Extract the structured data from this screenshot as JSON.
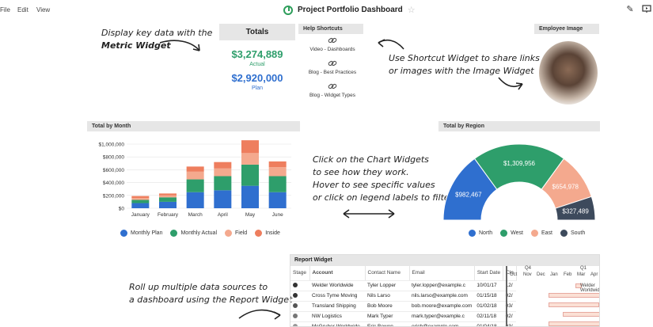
{
  "menu": [
    "File",
    "Edit",
    "View"
  ],
  "app_title": "Project Portfolio Dashboard",
  "notes": {
    "metric": [
      "Display key data with the",
      "Metric Widget"
    ],
    "shortcut": [
      "Use Shortcut Widget to share links",
      "or images with the Image Widget"
    ],
    "chart": [
      "Click on the Chart Widgets",
      "to see how they work.",
      "Hover to see specific values",
      "or click on legend labels to filter"
    ],
    "report": [
      "Roll up multiple data sources to",
      "a dashboard using the Report Widget"
    ]
  },
  "totals": {
    "title": "Totals",
    "actual_value": "$3,274,889",
    "actual_label": "Actual",
    "plan_value": "$2,920,000",
    "plan_label": "Plan"
  },
  "help_shortcuts": {
    "title": "Help Shortcuts",
    "items": [
      "Video - Dashboards",
      "Blog - Best Practices",
      "Blog - Widget Types"
    ]
  },
  "employee_image": {
    "title": "Employee Image"
  },
  "colors": {
    "plan": "#2f6fcf",
    "actual": "#2e9e6b",
    "field": "#f4a98e",
    "inside": "#ee7e5e",
    "north": "#2f6fcf",
    "west": "#2e9e6b",
    "east": "#f4a98e",
    "south": "#3d4a5c"
  },
  "chart_data": [
    {
      "type": "bar",
      "title": "Total by Month",
      "categories": [
        "January",
        "February",
        "March",
        "April",
        "May",
        "June"
      ],
      "ytick_labels": [
        "$1,000,000",
        "$800,000",
        "$600,000",
        "$400,000",
        "$200,000",
        "$0"
      ],
      "ylim": [
        0,
        1000000
      ],
      "stacked": true,
      "series": [
        {
          "name": "Monthly Plan",
          "values": [
            80000,
            100000,
            250000,
            280000,
            350000,
            250000
          ]
        },
        {
          "name": "Monthly Actual",
          "values": [
            50000,
            70000,
            200000,
            220000,
            330000,
            250000
          ]
        },
        {
          "name": "Field",
          "values": [
            30000,
            30000,
            120000,
            120000,
            180000,
            140000
          ]
        },
        {
          "name": "Inside",
          "values": [
            30000,
            30000,
            80000,
            100000,
            200000,
            90000
          ]
        }
      ]
    },
    {
      "type": "pie",
      "title": "Total by Region",
      "series": [
        {
          "name": "North",
          "value": 982467,
          "label": "$982,467"
        },
        {
          "name": "West",
          "value": 1309956,
          "label": "$1,309,956"
        },
        {
          "name": "East",
          "value": 654978,
          "label": "$654,978"
        },
        {
          "name": "South",
          "value": 327489,
          "label": "$327,489"
        }
      ]
    }
  ],
  "report": {
    "title": "Report Widget",
    "columns": [
      "Stage",
      "Account",
      "Contact Name",
      "Email",
      "Start Date",
      "Clo"
    ],
    "rows": [
      {
        "account": "Welder Worldwide",
        "contact": "Tyler Lopper",
        "email": "tyler.lopper@example.c",
        "start": "10/01/17",
        "close": "12/"
      },
      {
        "account": "Cross Tyme Moving",
        "contact": "Nils Larso",
        "email": "nils.larso@example.com",
        "start": "01/15/18",
        "close": "02/"
      },
      {
        "account": "Transland Shipping",
        "contact": "Bob Moore",
        "email": "bob.moore@example.com",
        "start": "01/02/18",
        "close": "03/"
      },
      {
        "account": "NW Logistics",
        "contact": "Mark Typer",
        "email": "mark.typer@example.c",
        "start": "02/11/18",
        "close": "02/"
      },
      {
        "account": "McGruber Worldwide",
        "contact": "Eric Bowen",
        "email": "ericb@example.com",
        "start": "01/04/18",
        "close": "03/"
      }
    ],
    "gantt": {
      "quarters": [
        "Q4",
        "Q1"
      ],
      "months": [
        "Oct",
        "Nov",
        "Dec",
        "Jan",
        "Feb",
        "Mar",
        "Apr"
      ],
      "bar_label": "Welder Worldwide"
    }
  }
}
